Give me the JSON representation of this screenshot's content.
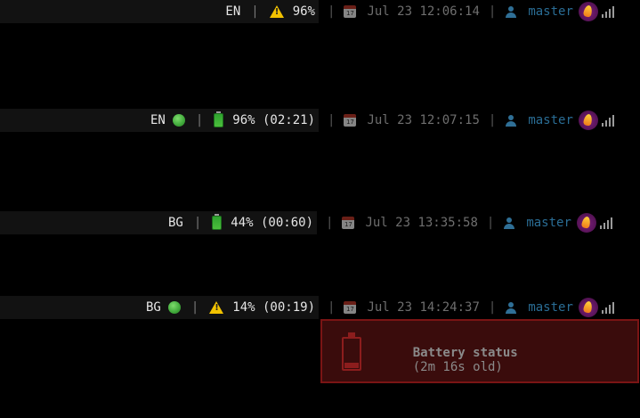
{
  "bars": [
    {
      "lang": "EN",
      "lang_indicator": false,
      "battery_icon": "warning-icon",
      "battery_text": "96%",
      "date_icon": "calendar-icon",
      "datetime": "Jul 23 12:06:14",
      "user_icon": "user-icon",
      "branch": "master",
      "separator": "|"
    },
    {
      "lang": "EN",
      "lang_indicator": true,
      "battery_icon": "battery-icon",
      "battery_text": "96% (02:21)",
      "date_icon": "calendar-icon",
      "datetime": "Jul 23 12:07:15",
      "user_icon": "user-icon",
      "branch": "master",
      "separator": "|"
    },
    {
      "lang": "BG",
      "lang_indicator": false,
      "battery_icon": "battery-icon",
      "battery_text": "44% (00:60)",
      "date_icon": "calendar-icon",
      "datetime": "Jul 23 13:35:58",
      "user_icon": "user-icon",
      "branch": "master",
      "separator": "|"
    },
    {
      "lang": "BG",
      "lang_indicator": true,
      "battery_icon": "warning-icon",
      "battery_text": "14% (00:19)",
      "date_icon": "calendar-icon",
      "datetime": "Jul 23 14:24:37",
      "user_icon": "user-icon",
      "branch": "master",
      "separator": "|"
    }
  ],
  "notification": {
    "icon": "battery-low-icon",
    "title": "Battery status",
    "age": "(2m 16s old)"
  },
  "colors": {
    "background": "#000000",
    "bar_left_bg": "#121212",
    "text_primary": "#e6e6e6",
    "text_dim": "#6e6e6e",
    "branch": "#2a6d95",
    "popup_bg": "#3a0c0c",
    "popup_border": "#7a1414",
    "warning": "#f2c200",
    "battery_green": "#2ea32e"
  }
}
